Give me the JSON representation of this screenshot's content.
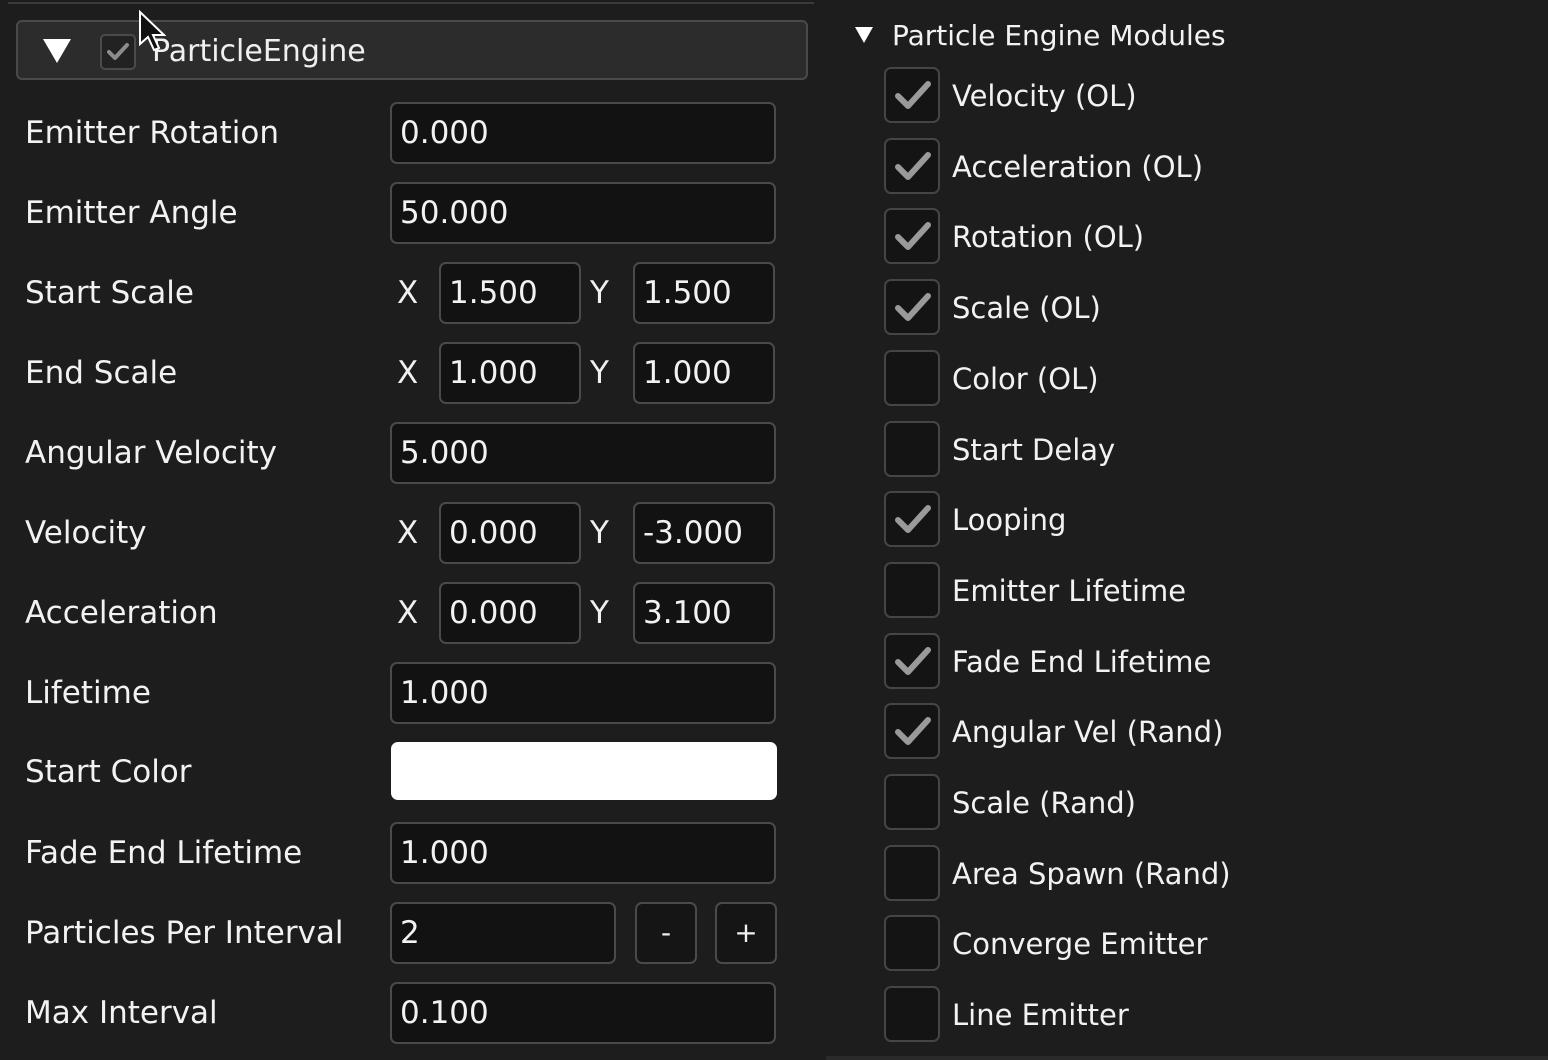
{
  "component": {
    "title": "ParticleEngine",
    "enabled": true
  },
  "properties": {
    "emitter_rotation": {
      "label": "Emitter Rotation",
      "value": "0.000"
    },
    "emitter_angle": {
      "label": "Emitter Angle",
      "value": "50.000"
    },
    "start_scale": {
      "label": "Start Scale",
      "x_label": "X",
      "x": "1.500",
      "y_label": "Y",
      "y": "1.500"
    },
    "end_scale": {
      "label": "End Scale",
      "x_label": "X",
      "x": "1.000",
      "y_label": "Y",
      "y": "1.000"
    },
    "angular_velocity": {
      "label": "Angular Velocity",
      "value": "5.000"
    },
    "velocity": {
      "label": "Velocity",
      "x_label": "X",
      "x": "0.000",
      "y_label": "Y",
      "y": "-3.000"
    },
    "acceleration": {
      "label": "Acceleration",
      "x_label": "X",
      "x": "0.000",
      "y_label": "Y",
      "y": "3.100"
    },
    "lifetime": {
      "label": "Lifetime",
      "value": "1.000"
    },
    "start_color": {
      "label": "Start Color",
      "color": "#ffffff"
    },
    "fade_end_lifetime": {
      "label": "Fade End Lifetime",
      "value": "1.000"
    },
    "particles_per_interval": {
      "label": "Particles Per Interval",
      "value": "2",
      "decrement_label": "-",
      "increment_label": "+"
    },
    "max_interval": {
      "label": "Max Interval",
      "value": "0.100"
    }
  },
  "modules": {
    "title": "Particle Engine Modules",
    "items": [
      {
        "label": "Velocity (OL)",
        "checked": true
      },
      {
        "label": "Acceleration (OL)",
        "checked": true
      },
      {
        "label": "Rotation (OL)",
        "checked": true
      },
      {
        "label": "Scale (OL)",
        "checked": true
      },
      {
        "label": "Color (OL)",
        "checked": false
      },
      {
        "label": "Start Delay",
        "checked": false
      },
      {
        "label": "Looping",
        "checked": true
      },
      {
        "label": "Emitter Lifetime",
        "checked": false
      },
      {
        "label": "Fade End Lifetime",
        "checked": true
      },
      {
        "label": "Angular Vel (Rand)",
        "checked": true
      },
      {
        "label": "Scale (Rand)",
        "checked": false
      },
      {
        "label": "Area Spawn (Rand)",
        "checked": false
      },
      {
        "label": "Converge Emitter",
        "checked": false
      },
      {
        "label": "Line Emitter",
        "checked": false
      }
    ]
  },
  "colors": {
    "panel_bg": "#1d1d1d",
    "field_bg": "#121212",
    "border": "#4a4a4a",
    "check": "#9a9a9a",
    "text": "#f2f2f2"
  }
}
